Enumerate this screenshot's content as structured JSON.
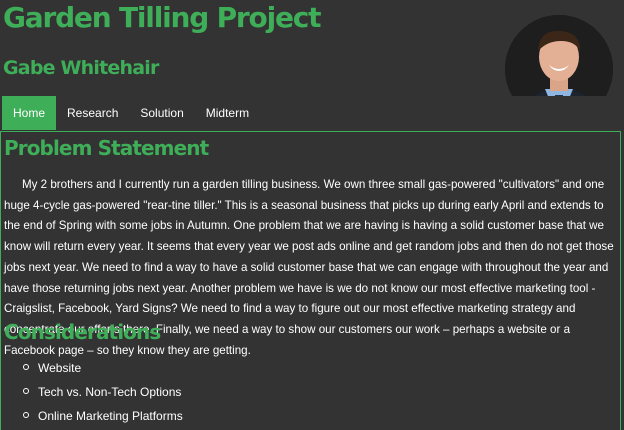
{
  "header": {
    "title": "Garden Tilling Project",
    "author": "Gabe Whitehair"
  },
  "nav": [
    {
      "label": "Home",
      "active": true
    },
    {
      "label": "Research",
      "active": false
    },
    {
      "label": "Solution",
      "active": false
    },
    {
      "label": "Midterm",
      "active": false
    }
  ],
  "problem": {
    "heading": "Problem Statement",
    "text": "My 2 brothers and I currently run a garden tilling business. We own three small gas-powered \"cultivators\" and one huge 4-cycle gas-powered \"rear-tine tiller.\" This is a seasonal business that picks up during early April and extends to the end of Spring with some jobs in Autumn. One problem that we are having is having a solid customer base that we know will return every year. It seems that every year we post ads online and get random jobs and then do not get those jobs next year. We need to find a way to have a solid customer base that we can engage with throughout the year and have those returning jobs next year. Another problem we have is we do not know our most effective marketing tool - Craigslist, Facebook, Yard Signs? We need to find a way to figure out our most effective marketing strategy and concentrate our efforts there. Finally, we need a way to show our customers our work – perhaps a website or a Facebook page – so they know they are getting."
  },
  "considerations": {
    "heading": "Considerations",
    "items": [
      "Website",
      "Tech vs. Non-Tech Options",
      "Online Marketing Platforms"
    ]
  },
  "colors": {
    "accent": "#3fae58",
    "background": "#333333",
    "text": "#ffffff"
  }
}
